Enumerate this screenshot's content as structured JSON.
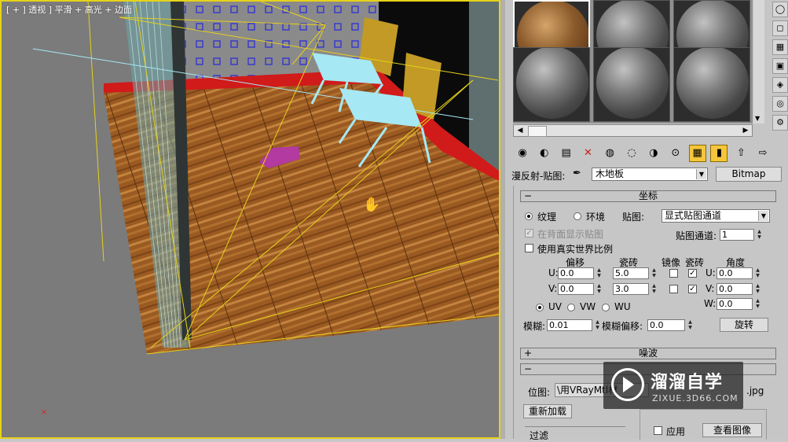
{
  "viewport": {
    "label": "[ + ] 透视 ] 平滑 + 高光 + 边面"
  },
  "material_editor": {
    "toolbar_icons": [
      "get-material-icon",
      "put-to-scene-icon",
      "assign-material-icon",
      "reset-icon",
      "make-copy-icon",
      "make-unique-icon",
      "put-to-library-icon",
      "material-id-icon",
      "show-map-icon",
      "show-end-result-icon",
      "go-to-parent-icon",
      "go-forward-icon"
    ],
    "map_line": {
      "label": "漫反射-贴图:",
      "map_name": "木地板",
      "type_button": "Bitmap"
    },
    "coordinates": {
      "title": "坐标",
      "texture_label": "纹理",
      "environ_label": "环境",
      "mapping_label": "贴图:",
      "mapping_value": "显式贴图通道",
      "show_back_label": "在背面显示贴图",
      "map_channel_label": "贴图通道:",
      "map_channel_value": "1",
      "real_world_label": "使用真实世界比例",
      "offset_header": "偏移",
      "tiling_header": "瓷砖",
      "mirror_header": "镜像",
      "tile_header": "瓷砖",
      "angle_header": "角度",
      "u_label": "U:",
      "v_label": "V:",
      "w_label": "W:",
      "u_offset": "0.0",
      "v_offset": "0.0",
      "u_tiling": "5.0",
      "v_tiling": "3.0",
      "u_angle": "0.0",
      "v_angle": "0.0",
      "w_angle": "0.0",
      "uv_label": "UV",
      "vw_label": "VW",
      "wu_label": "WU",
      "blur_label": "模糊:",
      "blur_value": "0.01",
      "blur_offset_label": "模糊偏移:",
      "blur_offset_value": "0.0",
      "rotate_button": "旋转"
    },
    "noise": {
      "title": "噪波"
    },
    "bitmap_params": {
      "bitmap_label": "位图:",
      "bitmap_path": "\\用VRayMtl材",
      "bitmap_ext": ".jpg",
      "reload_button": "重新加载",
      "filter_label": "过滤",
      "apply_label": "应用",
      "view_image_button": "查看图像"
    }
  },
  "watermark": {
    "title": "溜溜自学",
    "url": "ZIXUE.3D66.COM"
  },
  "colors": {
    "viewport_border": "#e6d21a",
    "floor_wood": "#9a5a22",
    "wall_trim": "#d11a1a",
    "chair_fabric": "#a6e8f4",
    "chair_back": "#c29a25",
    "highlight_button": "#f5c63c"
  }
}
